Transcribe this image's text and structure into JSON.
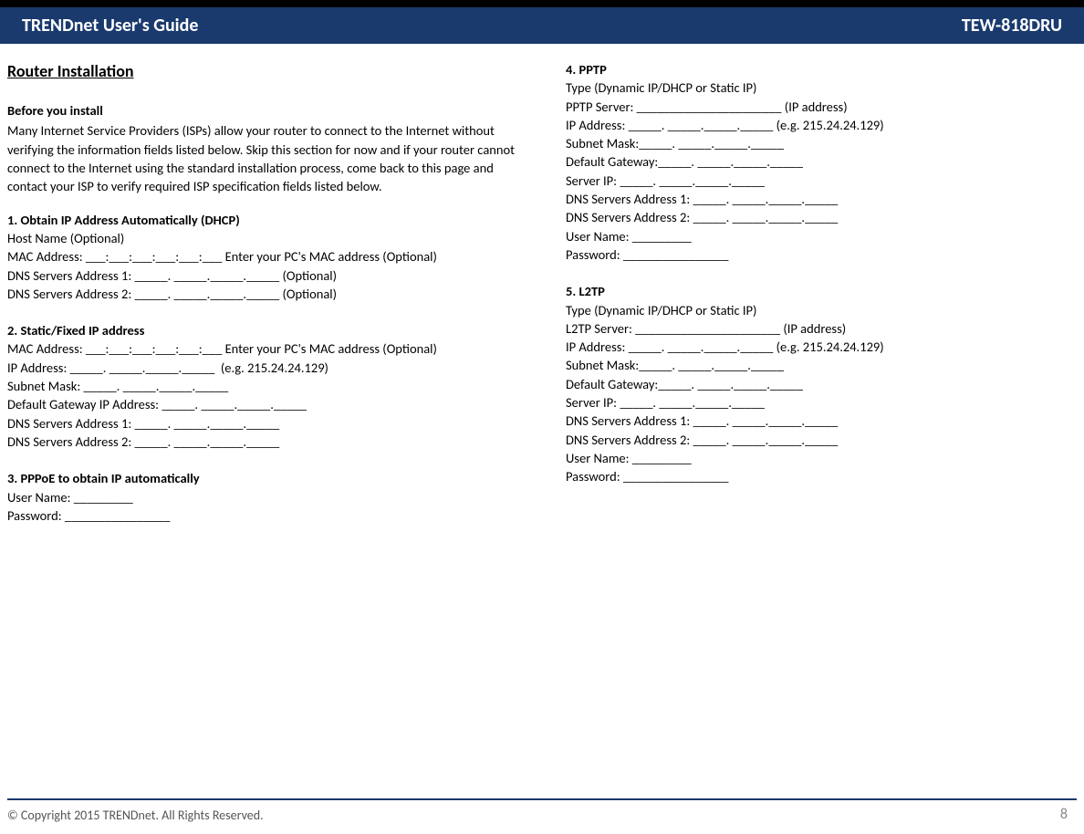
{
  "header": {
    "left": "TRENDnet User's Guide",
    "right": "TEW-818DRU"
  },
  "left": {
    "heading": "Router Installation",
    "before_install_title": "Before you install",
    "before_install_body": "Many Internet Service Providers (ISPs) allow your router to connect to the Internet without verifying the information fields listed below. Skip this section for now and if your router cannot connect to the Internet using the standard installation process, come back to this page and contact your ISP to verify required ISP specification fields listed below.",
    "section1_title": "1. Obtain IP Address Automatically (DHCP)",
    "section1_lines": [
      "Host Name (Optional)",
      "MAC Address: ___:___:___:___:___:___ Enter your PC's MAC address (Optional)",
      "DNS Servers Address 1: _____. _____._____._____ (Optional)",
      "DNS Servers Address 2: _____. _____._____._____ (Optional)"
    ],
    "section2_title": "2. Static/Fixed IP address",
    "section2_lines": [
      "MAC Address: ___:___:___:___:___:___ Enter your PC's MAC address (Optional)",
      "IP Address: _____. _____._____._____  (e.g. 215.24.24.129)",
      "Subnet Mask: _____. _____._____._____",
      "Default Gateway IP Address: _____. _____._____._____",
      "DNS Servers Address 1: _____. _____._____._____",
      "DNS Servers Address 2: _____. _____._____._____"
    ],
    "section3_title": "3. PPPoE to obtain IP automatically",
    "section3_lines": [
      "User Name: _________",
      "Password: ________________"
    ]
  },
  "right": {
    "section4_title": "4. PPTP",
    "section4_lines": [
      "Type (Dynamic IP/DHCP or Static IP)",
      "PPTP Server: ______________________ (IP address)",
      "IP Address: _____. _____._____._____ (e.g. 215.24.24.129)",
      "Subnet Mask:_____. _____._____._____",
      "Default Gateway:_____. _____._____._____",
      "Server IP: _____. _____._____._____",
      "DNS Servers Address 1: _____. _____._____._____",
      "DNS Servers Address 2: _____. _____._____._____",
      "User Name: _________",
      "Password: ________________"
    ],
    "section5_title": "5. L2TP",
    "section5_lines": [
      "Type (Dynamic IP/DHCP or Static IP)",
      "L2TP Server: ______________________ (IP address)",
      "IP Address: _____. _____._____._____ (e.g. 215.24.24.129)",
      "Subnet Mask:_____. _____._____._____",
      "Default Gateway:_____. _____._____._____",
      "Server IP: _____. _____._____._____",
      "DNS Servers Address 1: _____. _____._____._____",
      "DNS Servers Address 2: _____. _____._____._____",
      "User Name: _________",
      "Password: ________________"
    ]
  },
  "footer": {
    "copyright": "© Copyright 2015 TRENDnet. All Rights Reserved.",
    "page": "8"
  }
}
